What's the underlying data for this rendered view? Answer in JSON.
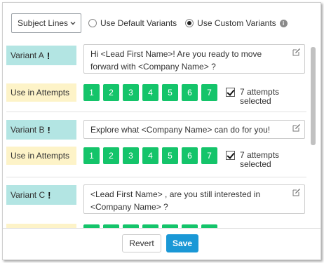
{
  "header": {
    "type_select": "Subject Lines",
    "radio_default": "Use Default Variants",
    "radio_custom": "Use Custom Variants",
    "info_glyph": "i"
  },
  "variants": [
    {
      "label": "Variant A",
      "message": "Hi <Lead First Name>! Are you ready to move forward with <Company Name> ?",
      "attempts_label": "Use in Attempts",
      "attempts": [
        "1",
        "2",
        "3",
        "4",
        "5",
        "6",
        "7"
      ],
      "selected_text": "7 attempts selected"
    },
    {
      "label": "Variant B",
      "message": "Explore what <Company Name> can do for you!",
      "attempts_label": "Use in Attempts",
      "attempts": [
        "1",
        "2",
        "3",
        "4",
        "5",
        "6",
        "7"
      ],
      "selected_text": "7 attempts selected"
    },
    {
      "label": "Variant C",
      "message": "<Lead First Name> , are you still interested in <Company Name> ?"
    }
  ],
  "footer": {
    "revert": "Revert",
    "save": "Save"
  },
  "colors": {
    "variant_label_bg": "#b3e5e3",
    "attempts_label_bg": "#fdf3c8",
    "attempt_button": "#14c46a",
    "save_button": "#1a98d6"
  }
}
